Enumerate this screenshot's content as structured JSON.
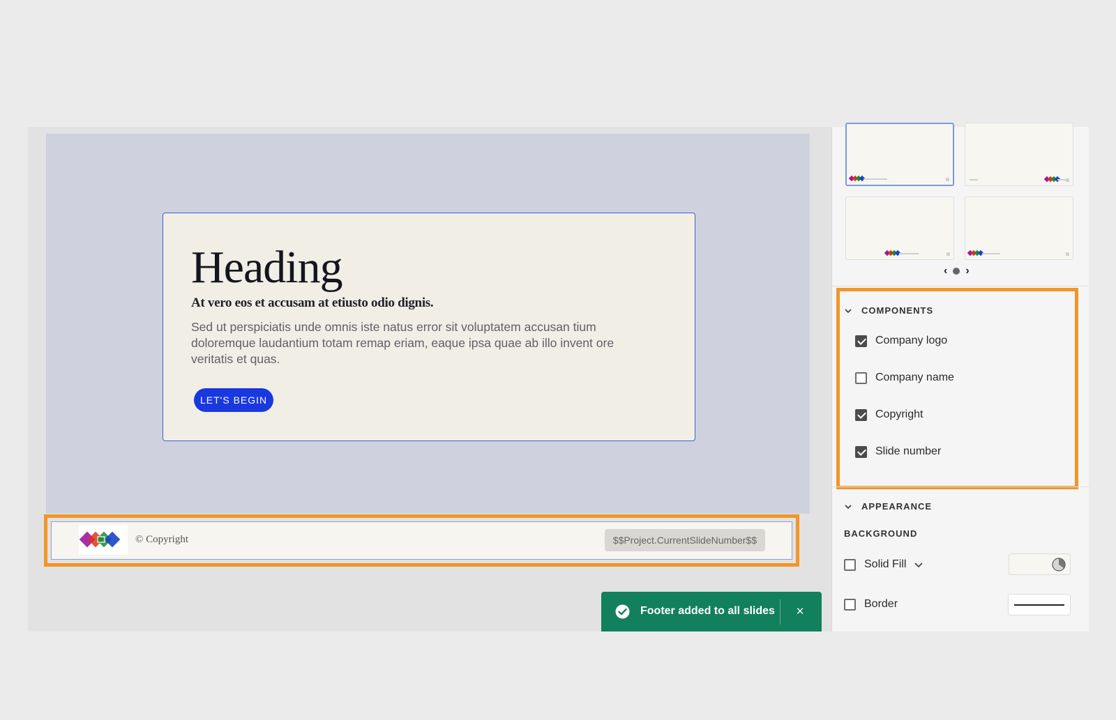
{
  "slide": {
    "heading": "Heading",
    "subheading": "At vero eos et accusam at etiusto odio dignis.",
    "body": "Sed ut perspiciatis unde omnis iste natus error sit voluptatem accusan tium doloremque laudantium totam remap eriam, eaque ipsa quae ab illo invent ore veritatis et quas.",
    "cta_label": "LET'S BEGIN",
    "footer": {
      "copyright": "© Copyright",
      "slide_number": "$$Project.CurrentSlideNumber$$"
    }
  },
  "toast": {
    "message": "Footer added to all slides",
    "close_glyph": "×",
    "icon": "checkmark-circle-icon"
  },
  "panel": {
    "pager": {
      "prev": "‹",
      "next": "›"
    },
    "components": {
      "title": "COMPONENTS",
      "items": [
        {
          "label": "Company logo",
          "checked": true
        },
        {
          "label": "Company name",
          "checked": false
        },
        {
          "label": "Copyright",
          "checked": true
        },
        {
          "label": "Slide number",
          "checked": true
        }
      ]
    },
    "appearance": {
      "title": "APPEARANCE",
      "background_label": "BACKGROUND",
      "solid_fill_label": "Solid Fill",
      "border_label": "Border"
    }
  },
  "colors": {
    "highlight": "#f0962a",
    "toast": "#12805c",
    "cta": "#1938e0",
    "slide_bg": "#cfd2de",
    "card_bg": "#f1eee6",
    "card_border": "#3a5fd9"
  }
}
